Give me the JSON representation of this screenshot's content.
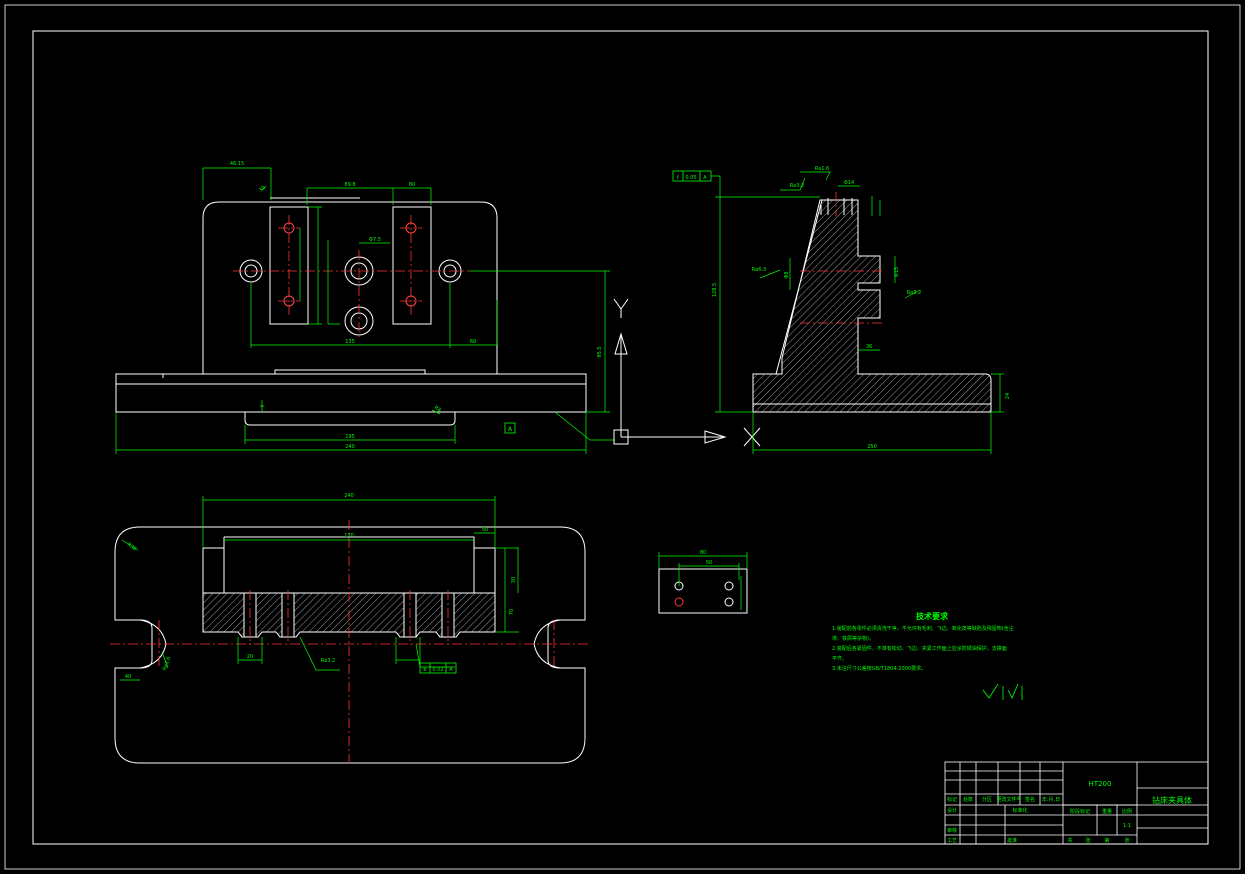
{
  "notes": {
    "title": "技术要求",
    "lines": [
      "1.装配前各零件必须清洗干净，不允许有毛刺、飞边、氧化皮等缺陷及残留物(含尘",
      "埃、铁屑等杂物)。",
      "2.装配后各紧固件，不准有松动、飞边、夹紧工作面上应涂防锈油保护，支撑面",
      "平齐。",
      "3.未注尺寸公差按GB/T1804-2000要求。"
    ]
  },
  "title_block": {
    "material": "HT200",
    "drawing_name": "钻床夹具体",
    "scale": "1:1",
    "headers": [
      "标记",
      "处数",
      "分区",
      "更改文件号",
      "签名",
      "年.月.日"
    ],
    "labels": {
      "design": "设计",
      "standardization": "标准化",
      "stage_mark": "阶段标记",
      "weight": "重量",
      "ratio": "比例",
      "audit": "审核",
      "process": "工艺",
      "approve": "批准"
    },
    "footer": [
      "共",
      "张",
      "第",
      "张"
    ]
  },
  "dims": {
    "d_4615": "46.15",
    "d_a1": "30",
    "d_898": "89.8",
    "d_80": "80",
    "d_135": "135",
    "d_60": "60",
    "d_95": "95.5",
    "d_195": "195",
    "d_240": "240",
    "d_front_r": "R8",
    "d_dia": "Φ7.5",
    "d_top": "240",
    "d_170": "170",
    "d_plan_r": "R38",
    "d_plan_w": "40",
    "d_50": "50",
    "d_70": "70",
    "d_30b": "30",
    "d_slot": "20",
    "d_side_h": "128.5",
    "d_side_w": "250",
    "d_side_t": "24",
    "d_side_s": "36",
    "d_side_d": "Φ15",
    "d_side_c": "Φ8",
    "d_side_u": "Φ14",
    "d_det_w": "80",
    "d_det_i": "50",
    "ra_1": "Ra1.6",
    "ra_2": "Ra3.2",
    "ra_3": "Ra6.3",
    "ra_4": "Ra3.2",
    "ra_5": "Ra3.2",
    "ra_6": "Ra1.6",
    "tol_1": "0.05",
    "tol_2": "0.02",
    "datum_a": "A",
    "datum_b": "b",
    "datum_f": "f"
  },
  "axes": {
    "y": "Y",
    "x": "X"
  }
}
